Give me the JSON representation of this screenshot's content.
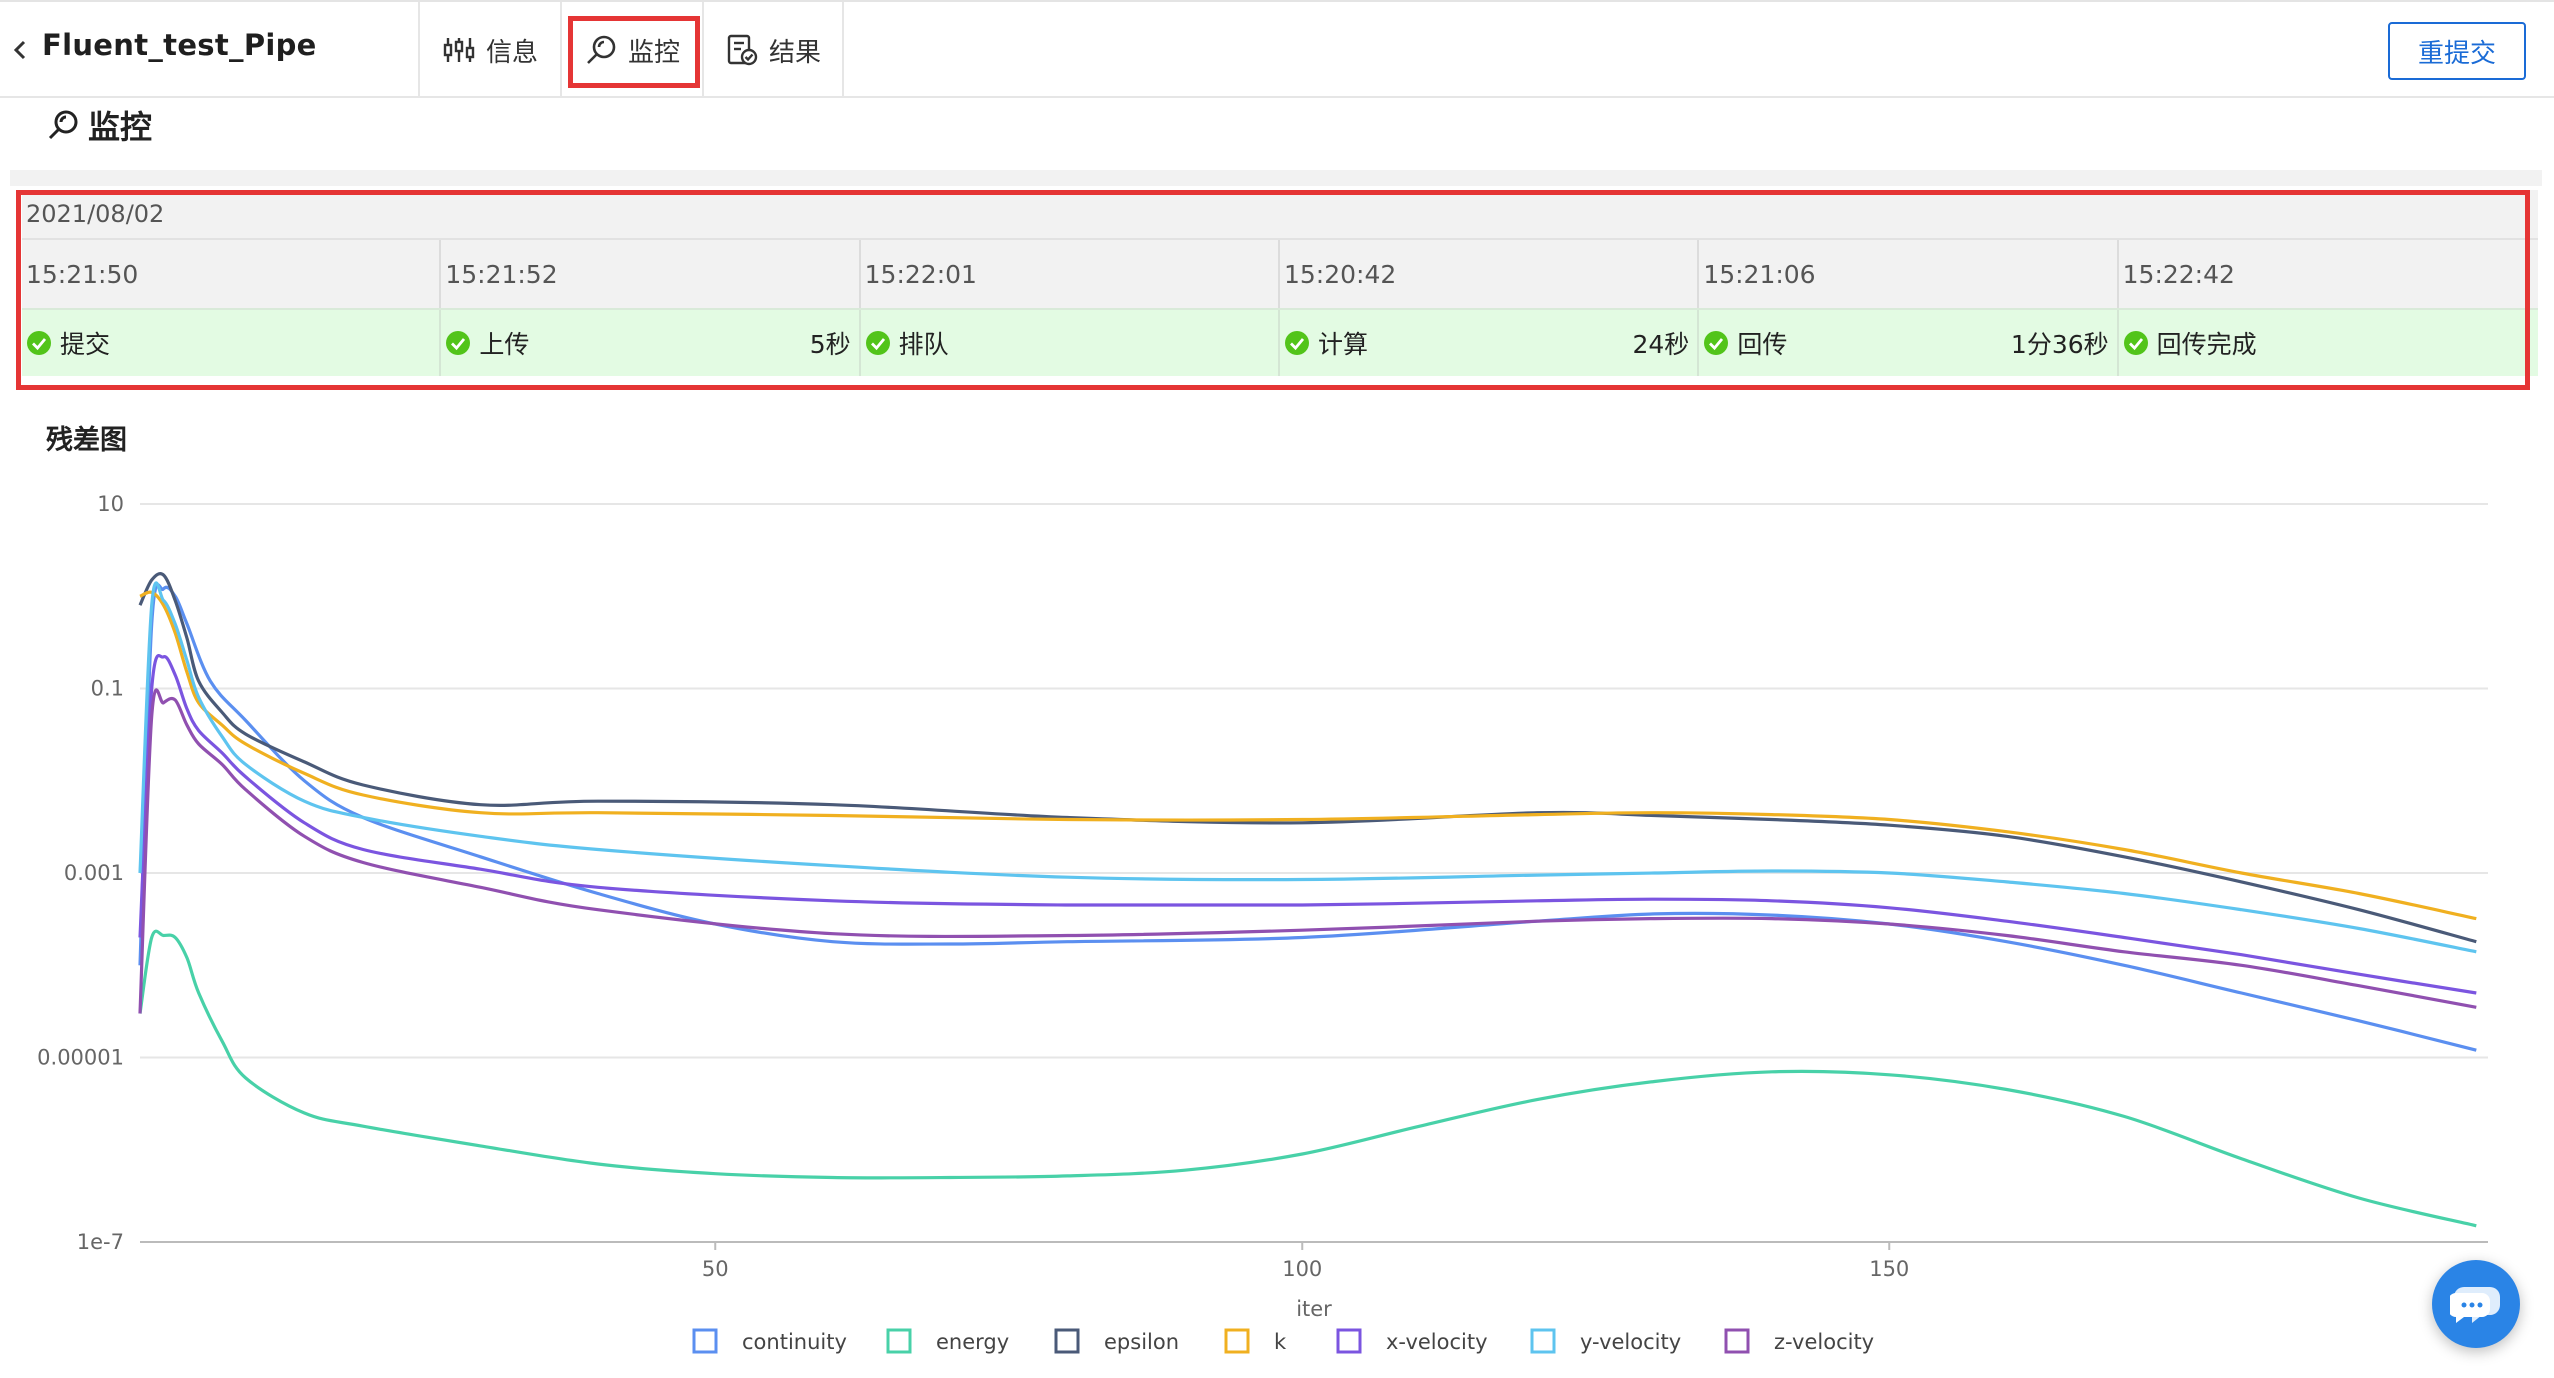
{
  "header": {
    "title": "Fluent_test_Pipe",
    "tabs": [
      {
        "label": "信息",
        "icon": "sliders-icon"
      },
      {
        "label": "监控",
        "icon": "search-monitor-icon",
        "active": true
      },
      {
        "label": "结果",
        "icon": "result-doc-icon"
      }
    ],
    "resubmit_label": "重提交"
  },
  "section": {
    "title": "监控"
  },
  "timeline": {
    "date": "2021/08/02",
    "times": [
      "15:21:50",
      "15:21:52",
      "15:22:01",
      "15:20:42",
      "15:21:06",
      "15:22:42"
    ],
    "steps": [
      {
        "label": "提交",
        "duration": ""
      },
      {
        "label": "上传",
        "duration": "5秒"
      },
      {
        "label": "排队",
        "duration": ""
      },
      {
        "label": "计算",
        "duration": "24秒"
      },
      {
        "label": "回传",
        "duration": "1分36秒"
      },
      {
        "label": "回传完成",
        "duration": ""
      }
    ],
    "status_color": "#52c41a"
  },
  "chart_title": "残差图",
  "chart_data": {
    "type": "line",
    "title": "残差图",
    "xlabel": "iter",
    "ylabel": "",
    "yscale": "log",
    "xlim": [
      1,
      201
    ],
    "ylim_exp": [
      -7,
      1
    ],
    "y_ticks": [
      "10",
      "0.1",
      "0.001",
      "0.00001",
      "1e-7"
    ],
    "x_ticks": [
      50,
      100,
      150
    ],
    "grid": true,
    "legend_position": "bottom",
    "series": [
      {
        "name": "continuity",
        "color": "#5b8ff0",
        "x": [
          1,
          2,
          3,
          4,
          5,
          7,
          10,
          15,
          20,
          30,
          40,
          50,
          60,
          70,
          80,
          100,
          120,
          130,
          140,
          150,
          160,
          170,
          180,
          190,
          200
        ],
        "y": [
          0.0001,
          0.5,
          1.2,
          1.0,
          0.5,
          0.12,
          0.045,
          0.01,
          0.004,
          0.0015,
          0.0006,
          0.00028,
          0.00018,
          0.00017,
          0.00018,
          0.0002,
          0.0003,
          0.00036,
          0.00035,
          0.00028,
          0.00018,
          0.0001,
          5e-05,
          2.5e-05,
          1.2e-05
        ]
      },
      {
        "name": "energy",
        "color": "#48d1a8",
        "x": [
          1,
          2,
          3,
          4,
          5,
          6,
          8,
          10,
          15,
          20,
          30,
          40,
          50,
          60,
          70,
          80,
          90,
          100,
          110,
          120,
          130,
          140,
          150,
          160,
          170,
          180,
          190,
          200
        ],
        "y": [
          3e-05,
          0.0002,
          0.00021,
          0.0002,
          0.00012,
          5e-05,
          1.5e-05,
          6e-06,
          2.5e-06,
          1.8e-06,
          1.1e-06,
          7e-07,
          5.5e-07,
          5e-07,
          5e-07,
          5.2e-07,
          6e-07,
          9e-07,
          1.8e-06,
          3.5e-06,
          5.5e-06,
          7e-06,
          6.5e-06,
          4.5e-06,
          2.3e-06,
          8e-07,
          3e-07,
          1.5e-07
        ]
      },
      {
        "name": "epsilon",
        "color": "#4a5a78",
        "x": [
          1,
          2,
          3,
          4,
          5,
          6,
          8,
          10,
          15,
          20,
          30,
          40,
          60,
          80,
          100,
          120,
          130,
          140,
          150,
          160,
          170,
          180,
          190,
          200
        ],
        "y": [
          0.8,
          1.5,
          1.7,
          0.9,
          0.35,
          0.12,
          0.055,
          0.032,
          0.016,
          0.009,
          0.0055,
          0.006,
          0.0055,
          0.004,
          0.0035,
          0.0045,
          0.0042,
          0.0038,
          0.0033,
          0.0025,
          0.0015,
          0.0008,
          0.0004,
          0.00018
        ]
      },
      {
        "name": "k",
        "color": "#f0b020",
        "x": [
          1,
          2,
          3,
          4,
          5,
          6,
          8,
          10,
          15,
          20,
          30,
          40,
          60,
          80,
          100,
          120,
          130,
          140,
          150,
          160,
          170,
          180,
          190,
          200
        ],
        "y": [
          1.0,
          1.1,
          0.8,
          0.4,
          0.15,
          0.07,
          0.04,
          0.025,
          0.012,
          0.007,
          0.0045,
          0.0045,
          0.0042,
          0.0038,
          0.0038,
          0.0043,
          0.0045,
          0.0043,
          0.0038,
          0.0028,
          0.0018,
          0.001,
          0.0006,
          0.00032
        ]
      },
      {
        "name": "x-velocity",
        "color": "#7b55e0",
        "x": [
          1,
          2,
          3,
          4,
          5,
          6,
          8,
          10,
          15,
          20,
          30,
          40,
          60,
          80,
          100,
          120,
          130,
          140,
          150,
          160,
          170,
          180,
          190,
          200
        ],
        "y": [
          0.0002,
          0.1,
          0.22,
          0.14,
          0.06,
          0.035,
          0.02,
          0.011,
          0.0035,
          0.0018,
          0.0011,
          0.0007,
          0.0005,
          0.00045,
          0.00045,
          0.0005,
          0.00052,
          0.0005,
          0.00042,
          0.0003,
          0.0002,
          0.00013,
          8e-05,
          5e-05
        ]
      },
      {
        "name": "y-velocity",
        "color": "#5ec4ef",
        "x": [
          1,
          2,
          3,
          4,
          5,
          6,
          8,
          10,
          15,
          20,
          30,
          40,
          60,
          80,
          100,
          120,
          130,
          140,
          150,
          160,
          170,
          180,
          190,
          200
        ],
        "y": [
          0.001,
          0.8,
          0.9,
          0.5,
          0.2,
          0.08,
          0.03,
          0.015,
          0.006,
          0.004,
          0.0025,
          0.0018,
          0.0012,
          0.0009,
          0.00085,
          0.00095,
          0.001,
          0.00105,
          0.001,
          0.0008,
          0.0006,
          0.0004,
          0.00025,
          0.00014
        ]
      },
      {
        "name": "z-velocity",
        "color": "#9050b0",
        "x": [
          1,
          2,
          3,
          4,
          5,
          6,
          8,
          10,
          15,
          20,
          30,
          40,
          60,
          80,
          100,
          120,
          130,
          140,
          150,
          160,
          170,
          180,
          190,
          200
        ],
        "y": [
          3e-05,
          0.05,
          0.07,
          0.075,
          0.04,
          0.025,
          0.015,
          0.008,
          0.0025,
          0.0013,
          0.0007,
          0.0004,
          0.00022,
          0.00021,
          0.00024,
          0.0003,
          0.00032,
          0.00032,
          0.00028,
          0.00021,
          0.00014,
          0.0001,
          6e-05,
          3.5e-05
        ]
      }
    ]
  }
}
